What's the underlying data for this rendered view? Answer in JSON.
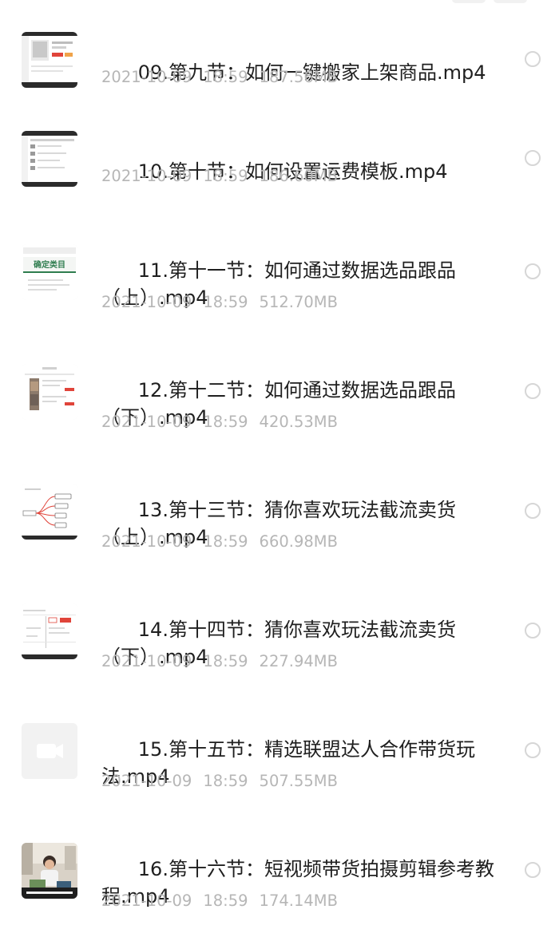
{
  "files": [
    {
      "name_line1": "09.第九节：如何一键搬家上架商品.mp4",
      "name_line2": "",
      "date": "2021-10-09",
      "time": "18:59",
      "size": "187.56MB",
      "thumb_icon": "video-thumbnail"
    },
    {
      "name_line1": "10.第十节：如何设置运费模板.mp4",
      "name_line2": "",
      "date": "2021-10-09",
      "time": "18:59",
      "size": "186.60MB",
      "thumb_icon": "video-thumbnail"
    },
    {
      "name_line1": "11.第十一节：如何通过数据选品跟品",
      "name_line2": "（上）.mp4",
      "date": "2021-10-09",
      "time": "18:59",
      "size": "512.70MB",
      "thumb_icon": "video-thumbnail",
      "thumb_text": "确定类目"
    },
    {
      "name_line1": "12.第十二节：如何通过数据选品跟品",
      "name_line2": "（下）.mp4",
      "date": "2021-10-09",
      "time": "18:59",
      "size": "420.53MB",
      "thumb_icon": "video-thumbnail"
    },
    {
      "name_line1": "13.第十三节：猜你喜欢玩法截流卖货",
      "name_line2": "（上）.mp4",
      "date": "2021-10-09",
      "time": "18:59",
      "size": "660.98MB",
      "thumb_icon": "video-thumbnail"
    },
    {
      "name_line1": "14.第十四节：猜你喜欢玩法截流卖货",
      "name_line2": "（下）.mp4",
      "date": "2021-10-09",
      "time": "18:59",
      "size": "227.94MB",
      "thumb_icon": "video-thumbnail"
    },
    {
      "name_line1": "15.第十五节：精选联盟达人合作带货玩",
      "name_line2": "法.mp4",
      "date": "2021-10-09",
      "time": "18:59",
      "size": "507.55MB",
      "thumb_icon": "video-camera-icon"
    },
    {
      "name_line1": "16.第十六节：短视频带货拍摄剪辑参考教",
      "name_line2": "程.mp4",
      "date": "2021-10-09",
      "time": "18:59",
      "size": "174.14MB",
      "thumb_icon": "video-thumbnail"
    }
  ],
  "colors": {
    "title_text": "#1f1f1f",
    "meta_text": "#b6b6b6",
    "radio_border": "#d6d6d6",
    "background": "#ffffff",
    "accent_green": "#2f7d4f",
    "accent_red": "#e0443a"
  }
}
